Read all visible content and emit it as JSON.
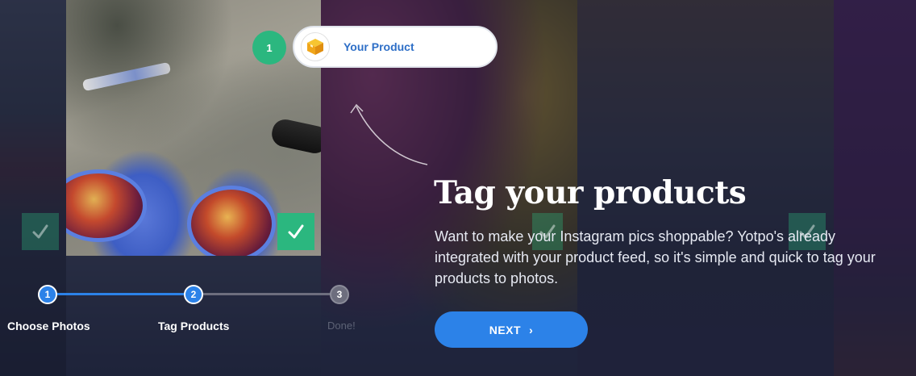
{
  "callout": {
    "number": "1",
    "label": "Your Product"
  },
  "headline": "Tag your products",
  "description": "Want to make your Instagram pics shoppable? Yotpo's already integrated with your product feed, so it's simple and quick to tag your products to photos.",
  "next_button": {
    "label": "NEXT",
    "icon": "chevron-right-icon"
  },
  "stepper": {
    "steps": [
      {
        "number": "1",
        "label": "Choose Photos",
        "state": "complete"
      },
      {
        "number": "2",
        "label": "Tag Products",
        "state": "active"
      },
      {
        "number": "3",
        "label": "Done!",
        "state": "pending"
      }
    ]
  },
  "colors": {
    "accent_blue": "#2c82e8",
    "check_green": "#2bb77f",
    "pending_gray": "#6d6e7e"
  }
}
